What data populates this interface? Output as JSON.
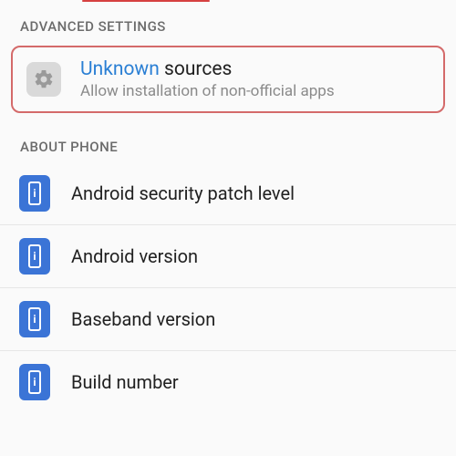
{
  "sections": {
    "advanced": {
      "header": "ADVANCED SETTINGS",
      "unknown_sources": {
        "title_accent": "Unknown",
        "title_rest": " sources",
        "subtitle": "Allow installation of non-official apps"
      }
    },
    "about": {
      "header": "ABOUT PHONE",
      "items": [
        {
          "label": "Android security patch level"
        },
        {
          "label": "Android version"
        },
        {
          "label": "Baseband version"
        },
        {
          "label": "Build number"
        }
      ]
    }
  }
}
